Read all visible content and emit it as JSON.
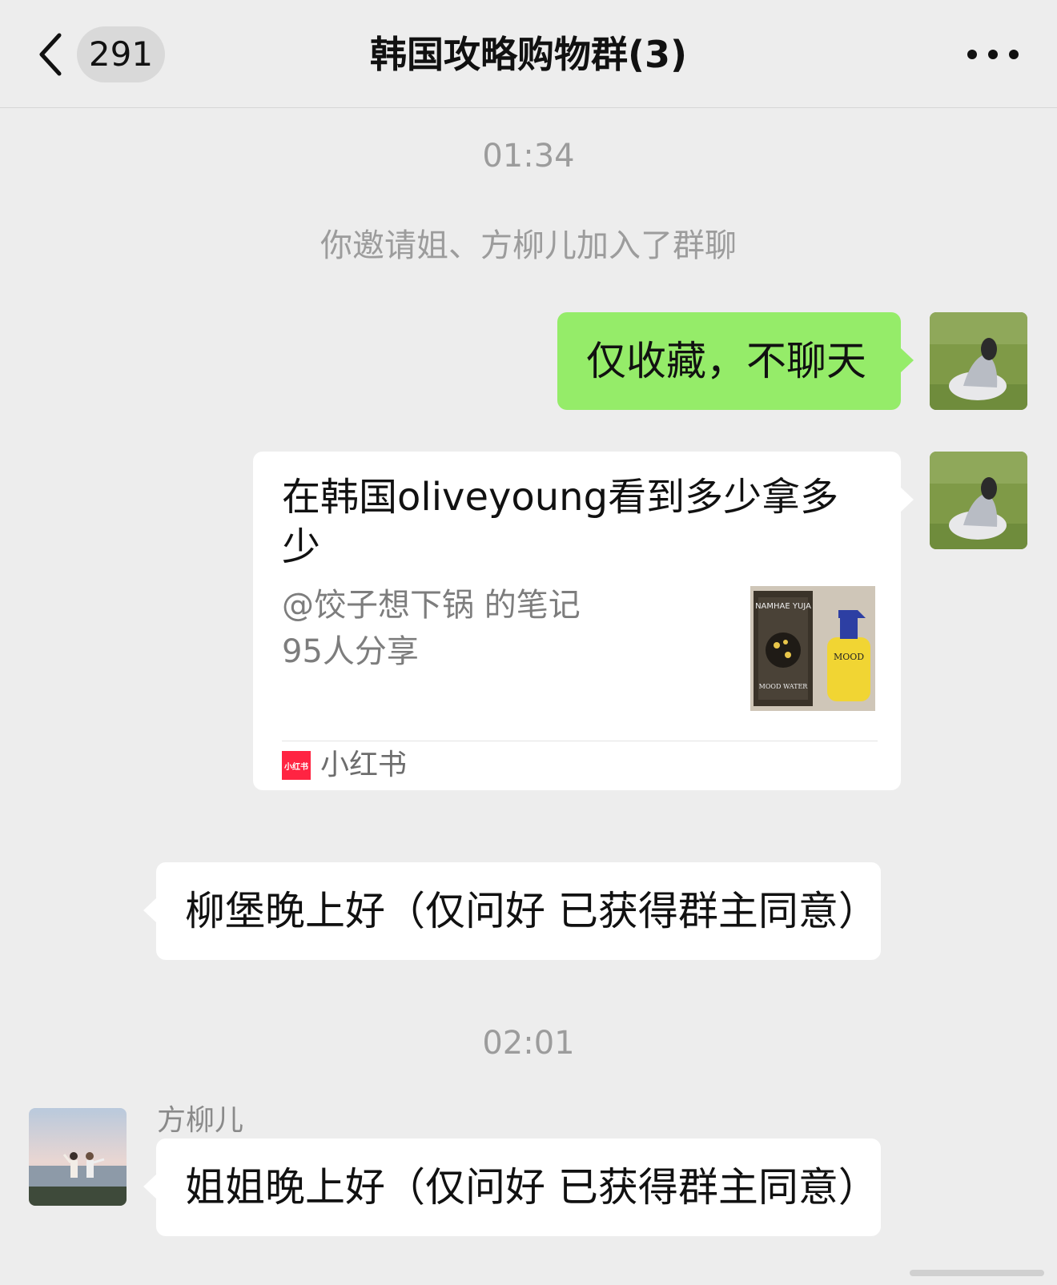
{
  "header": {
    "unread_count": "291",
    "title": "韩国攻略购物群(3)"
  },
  "messages": {
    "time_1": "01:34",
    "system_notice": "你邀请姐、方柳儿加入了群聊",
    "my_text": "仅收藏，不聊天",
    "card": {
      "title": "在韩国oliveyoung看到多少拿多少",
      "author": "@饺子想下锅 的笔记",
      "shares": "95人分享",
      "source_icon_text": "小红书",
      "source": "小红书",
      "thumb_text_top": "NAMHAE YUJA",
      "thumb_text_bottom": "MOOD WATER",
      "thumb_text_bottle": "MOOD"
    },
    "incoming_1": "柳堡晚上好（仅问好 已获得群主同意）",
    "time_2": "02:01",
    "sender_name": "方柳儿",
    "incoming_2": "姐姐晚上好（仅问好 已获得群主同意）"
  },
  "colors": {
    "background": "#ededed",
    "my_bubble": "#95ec69",
    "other_bubble": "#ffffff",
    "system_text": "#9c9c9c",
    "xhs_red": "#ff2442"
  },
  "icons": [
    "back-icon",
    "more-icon",
    "xiaohongshu-icon"
  ]
}
